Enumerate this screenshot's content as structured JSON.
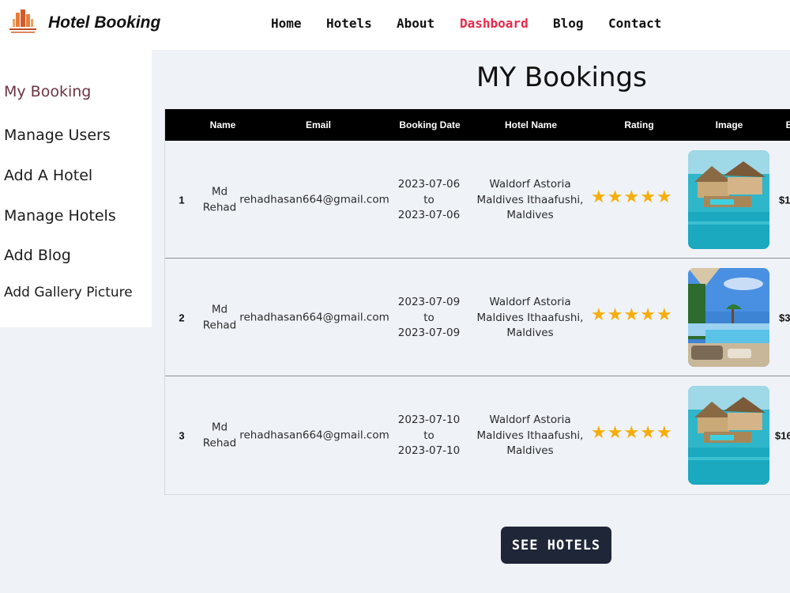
{
  "header": {
    "brand": "Hotel Booking",
    "nav": [
      "Home",
      "Hotels",
      "About",
      "Dashboard",
      "Blog",
      "Contact"
    ],
    "active_nav": "Dashboard",
    "accent_color": "#e8294a"
  },
  "sidebar": {
    "items": [
      "My Booking",
      "Manage Users",
      "Add A Hotel",
      "Manage Hotels",
      "Add Blog",
      "Add Gallery Picture"
    ],
    "active_item": "My Booking"
  },
  "main": {
    "title": "MY Bookings",
    "columns": [
      "Name",
      "Email",
      "Booking Date",
      "Hotel Name",
      "Rating",
      "Image",
      "B"
    ],
    "rows": [
      {
        "index": "1",
        "name_first": "Md",
        "name_last": "Rehad",
        "email": "rehadhasan664@gmail.com",
        "date_from": "2023-07-06",
        "date_to_word": "to",
        "date_to": "2023-07-06",
        "hotel_line1": "Waldorf Astoria",
        "hotel_line2": "Maldives Ithaafushi,",
        "hotel_line3": "Maldives",
        "rating": 5,
        "image_icon": "overwater-villa-photo",
        "price": "$1"
      },
      {
        "index": "2",
        "name_first": "Md",
        "name_last": "Rehad",
        "email": "rehadhasan664@gmail.com",
        "date_from": "2023-07-09",
        "date_to_word": "to",
        "date_to": "2023-07-09",
        "hotel_line1": "Waldorf Astoria",
        "hotel_line2": "Maldives Ithaafushi,",
        "hotel_line3": "Maldives",
        "rating": 5,
        "image_icon": "pool-beach-photo",
        "price": "$3"
      },
      {
        "index": "3",
        "name_first": "Md",
        "name_last": "Rehad",
        "email": "rehadhasan664@gmail.com",
        "date_from": "2023-07-10",
        "date_to_word": "to",
        "date_to": "2023-07-10",
        "hotel_line1": "Waldorf Astoria",
        "hotel_line2": "Maldives Ithaafushi,",
        "hotel_line3": "Maldives",
        "rating": 5,
        "image_icon": "overwater-villa-photo",
        "price": "$16"
      }
    ],
    "see_button": "SEE HOTELS"
  }
}
